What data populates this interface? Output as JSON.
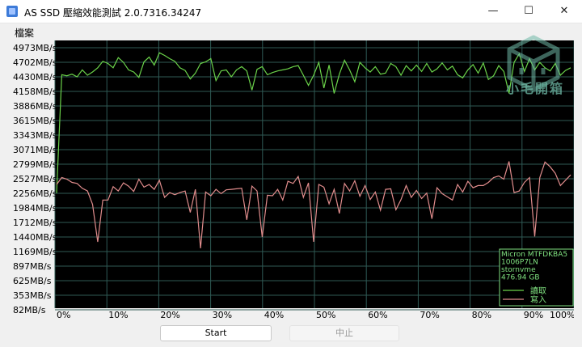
{
  "window": {
    "title": "AS SSD 壓縮效能測試 2.0.7316.34247",
    "minimize_glyph": "—",
    "maximize_glyph": "☐",
    "close_glyph": "✕"
  },
  "menu": {
    "file_label": "檔案"
  },
  "buttons": {
    "start_label": "Start",
    "stop_label": "中止"
  },
  "watermark": {
    "text": "小毛開箱"
  },
  "colors": {
    "plot_bg": "#000000",
    "grid": "#2f5a55",
    "read_series": "#6bd34a",
    "write_series": "#e08c8c",
    "legend_text": "#7fe07f"
  },
  "legend": {
    "device_lines": [
      "Micron MTFDKBA5",
      "1006P7LN",
      "stornvme",
      "476.94 GB"
    ],
    "read_label": "讀取",
    "write_label": "寫入"
  },
  "chart_data": {
    "type": "line",
    "ylabel_ticks": [
      "4973MB/s",
      "4702MB/s",
      "4430MB/s",
      "4158MB/s",
      "3886MB/s",
      "3615MB/s",
      "3343MB/s",
      "3071MB/s",
      "2799MB/s",
      "2527MB/s",
      "2256MB/s",
      "1984MB/s",
      "1712MB/s",
      "1440MB/s",
      "1169MB/s",
      "897MB/s",
      "625MB/s",
      "353MB/s",
      "82MB/s"
    ],
    "y_tick_values": [
      4973,
      4702,
      4430,
      4158,
      3886,
      3615,
      3343,
      3071,
      2799,
      2527,
      2256,
      1984,
      1712,
      1440,
      1169,
      897,
      625,
      353,
      82
    ],
    "x_ticks": [
      "0%",
      "10%",
      "20%",
      "30%",
      "40%",
      "50%",
      "60%",
      "70%",
      "80%",
      "90%",
      "100%"
    ],
    "xlim": [
      0,
      100
    ],
    "ylim": [
      82,
      4973
    ],
    "grid": true,
    "legend_position": "bottom-right",
    "series": [
      {
        "name": "讀取",
        "x": [
          0,
          1,
          2,
          3,
          4,
          5,
          6,
          7,
          8,
          9,
          10,
          11,
          12,
          13,
          14,
          15,
          16,
          17,
          18,
          19,
          20,
          21,
          22,
          23,
          24,
          25,
          26,
          27,
          28,
          29,
          30,
          31,
          32,
          33,
          34,
          35,
          36,
          37,
          38,
          39,
          40,
          41,
          42,
          43,
          44,
          45,
          46,
          47,
          48,
          49,
          50,
          51,
          52,
          53,
          54,
          55,
          56,
          57,
          58,
          59,
          60,
          61,
          62,
          63,
          64,
          65,
          66,
          67,
          68,
          69,
          70,
          71,
          72,
          73,
          74,
          75,
          76,
          77,
          78,
          79,
          80,
          81,
          82,
          83,
          84,
          85,
          86,
          87,
          88,
          89,
          90,
          91,
          92,
          93,
          94,
          95,
          96,
          97,
          98,
          99,
          100
        ],
        "values": [
          2260,
          4470,
          4450,
          4480,
          4430,
          4560,
          4460,
          4520,
          4600,
          4720,
          4680,
          4600,
          4790,
          4700,
          4560,
          4520,
          4420,
          4710,
          4800,
          4650,
          4880,
          4830,
          4770,
          4720,
          4600,
          4550,
          4390,
          4500,
          4680,
          4710,
          4770,
          4360,
          4540,
          4560,
          4430,
          4560,
          4620,
          4540,
          4180,
          4570,
          4620,
          4470,
          4510,
          4540,
          4560,
          4580,
          4620,
          4640,
          4460,
          4270,
          4460,
          4700,
          4220,
          4650,
          4120,
          4480,
          4740,
          4560,
          4340,
          4700,
          4600,
          4520,
          4620,
          4480,
          4500,
          4680,
          4620,
          4460,
          4640,
          4540,
          4650,
          4530,
          4680,
          4520,
          4580,
          4690,
          4560,
          4630,
          4470,
          4410,
          4560,
          4660,
          4500,
          4690,
          4380,
          4450,
          4640,
          4530,
          4120,
          4700,
          4860,
          4530,
          4770,
          4560,
          4700,
          4600,
          4540,
          4680,
          4460,
          4550,
          4600
        ]
      },
      {
        "name": "寫入",
        "x": [
          0,
          1,
          2,
          3,
          4,
          5,
          6,
          7,
          8,
          9,
          10,
          11,
          12,
          13,
          14,
          15,
          16,
          17,
          18,
          19,
          20,
          21,
          22,
          23,
          24,
          25,
          26,
          27,
          28,
          29,
          30,
          31,
          32,
          33,
          34,
          35,
          36,
          37,
          38,
          39,
          40,
          41,
          42,
          43,
          44,
          45,
          46,
          47,
          48,
          49,
          50,
          51,
          52,
          53,
          54,
          55,
          56,
          57,
          58,
          59,
          60,
          61,
          62,
          63,
          64,
          65,
          66,
          67,
          68,
          69,
          70,
          71,
          72,
          73,
          74,
          75,
          76,
          77,
          78,
          79,
          80,
          81,
          82,
          83,
          84,
          85,
          86,
          87,
          88,
          89,
          90,
          91,
          92,
          93,
          94,
          95,
          96,
          97,
          98,
          99,
          100
        ],
        "values": [
          2420,
          2550,
          2520,
          2460,
          2440,
          2350,
          2300,
          2050,
          1350,
          2130,
          2130,
          2380,
          2300,
          2450,
          2390,
          2290,
          2520,
          2370,
          2420,
          2330,
          2500,
          2180,
          2270,
          2230,
          2270,
          2300,
          1900,
          2330,
          1230,
          2280,
          2210,
          2330,
          2250,
          2320,
          2330,
          2340,
          2350,
          1760,
          2390,
          2300,
          1440,
          2220,
          2210,
          2330,
          2130,
          2480,
          2440,
          2570,
          2180,
          2450,
          1350,
          2420,
          2370,
          2060,
          2330,
          1880,
          2440,
          2300,
          2490,
          2200,
          2400,
          2140,
          2280,
          1940,
          2330,
          2340,
          1950,
          2140,
          2400,
          2180,
          2310,
          2160,
          2260,
          1780,
          2360,
          2250,
          2190,
          2130,
          2420,
          2280,
          2480,
          2360,
          2400,
          2400,
          2460,
          2550,
          2580,
          2520,
          2850,
          2270,
          2300,
          2460,
          2550,
          1450,
          2550,
          2840,
          2750,
          2630,
          2400,
          2500,
          2600
        ]
      }
    ]
  }
}
